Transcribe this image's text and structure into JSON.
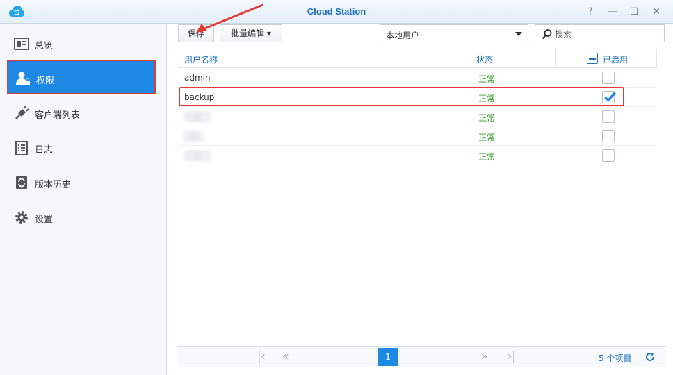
{
  "window": {
    "title": "Cloud Station",
    "help_glyph": "?",
    "minimize_glyph": "—",
    "maximize_glyph": "☐",
    "close_glyph": "✕"
  },
  "sidebar": {
    "items": [
      {
        "label": "总览",
        "icon": "overview-icon"
      },
      {
        "label": "权限",
        "icon": "user-lock-icon",
        "active": true
      },
      {
        "label": "客户端列表",
        "icon": "plug-icon"
      },
      {
        "label": "日志",
        "icon": "log-icon"
      },
      {
        "label": "版本历史",
        "icon": "history-icon"
      },
      {
        "label": "设置",
        "icon": "gear-icon"
      }
    ]
  },
  "toolbar": {
    "save_label": "保存",
    "batch_edit_label": "批量编辑 ▾",
    "user_type_value": "本地用户",
    "search_placeholder": "搜索"
  },
  "table": {
    "columns": [
      "用户名称",
      "状态",
      "已启用"
    ],
    "rows": [
      {
        "name": "admin",
        "status": "正常",
        "enabled": false
      },
      {
        "name": "backup",
        "status": "正常",
        "enabled": true
      },
      {
        "name": "",
        "status": "正常",
        "enabled": false
      },
      {
        "name": "",
        "status": "正常",
        "enabled": false
      },
      {
        "name": "",
        "status": "正常",
        "enabled": false
      }
    ]
  },
  "pager": {
    "first_glyph": "|‹",
    "prev_glyph": "«",
    "current_page": "1",
    "next_glyph": "»",
    "last_glyph": "›|",
    "count_label": "5 个项目"
  },
  "colors": {
    "accent": "#1e88e5",
    "highlight": "#e53935",
    "status_ok": "#3a9a2b",
    "title": "#1f74bf"
  }
}
